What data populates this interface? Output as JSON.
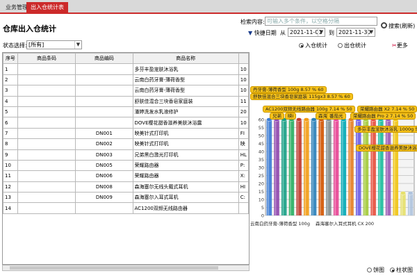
{
  "tabs": [
    {
      "label": "业务管理"
    },
    {
      "label": "出入仓统计表"
    }
  ],
  "page_title": "仓库出入仓统计",
  "search": {
    "label": "检索内容:",
    "placeholder": "可输入多个条件，以空格分隔",
    "button": "搜索(刷新)"
  },
  "date": {
    "label": "快捷日期",
    "from_label": "从",
    "from": "2021-11-01",
    "to_label": "到",
    "to": "2021-11-30"
  },
  "status": {
    "label": "状态选择:",
    "value": "[所有]"
  },
  "view_options": {
    "in_label": "入仓统计",
    "out_label": "出仓统计",
    "more_label": "更多",
    "selected": "in"
  },
  "chart_type": {
    "pie_label": "饼图",
    "bar_label": "柱状图",
    "selected": "bar"
  },
  "table": {
    "headers": [
      "序号",
      "商品条码",
      "商品编码",
      "商品名称",
      ""
    ],
    "rows": [
      {
        "no": "1",
        "barcode": "",
        "code": "",
        "name": "多芬丰盈宠肤沐浴乳",
        "extra": "10"
      },
      {
        "no": "2",
        "barcode": "",
        "code": "",
        "name": "云南白药牙膏-薄荷香型",
        "extra": "10"
      },
      {
        "no": "3",
        "barcode": "",
        "code": "",
        "name": "云南白药牙膏-薄荷香型",
        "extra": "10"
      },
      {
        "no": "4",
        "barcode": "",
        "code": "",
        "name": "舒肤佳混合三块香皂家庭装",
        "extra": "11"
      },
      {
        "no": "5",
        "barcode": "",
        "code": "",
        "name": "潘婷洗发水乳液修护",
        "extra": "20"
      },
      {
        "no": "6",
        "barcode": "",
        "code": "",
        "name": "DOVE樱花甜香滋养美肤沐浴露",
        "extra": "10"
      },
      {
        "no": "7",
        "barcode": "",
        "code": "DN001",
        "name": "映美针式打印机",
        "extra": "FI"
      },
      {
        "no": "8",
        "barcode": "",
        "code": "DN002",
        "name": "映美针式打印机",
        "extra": "映"
      },
      {
        "no": "9",
        "barcode": "",
        "code": "DN003",
        "name": "兄弟黑白激光打印机",
        "extra": "HL"
      },
      {
        "no": "10",
        "barcode": "",
        "code": "DN005",
        "name": "荣耀路由器",
        "extra": "P:"
      },
      {
        "no": "11",
        "barcode": "",
        "code": "DN006",
        "name": "荣耀路由器",
        "extra": "X:"
      },
      {
        "no": "12",
        "barcode": "",
        "code": "DN008",
        "name": "森海塞尔无线头戴式耳机",
        "extra": "HI"
      },
      {
        "no": "13",
        "barcode": "",
        "code": "DN009",
        "name": "森海塞尔入耳式耳机",
        "extra": "C:"
      },
      {
        "no": "14",
        "barcode": "",
        "code": "",
        "name": "AC1200双频无线路由器",
        "extra": ""
      }
    ]
  },
  "chart_data": {
    "type": "bar",
    "y_ticks": [
      "60",
      "55",
      "50",
      "45",
      "40",
      "35",
      "30",
      "25",
      "20",
      "15",
      "10",
      "5",
      "0"
    ],
    "ylim": [
      0,
      60
    ],
    "values": [
      60,
      60,
      60,
      60,
      60,
      60,
      60,
      60,
      60,
      60,
      60,
      60,
      60,
      60,
      60,
      60,
      60,
      60,
      14,
      14
    ],
    "bar_colors": [
      "#3a7bd5",
      "#8e44ad",
      "#16a085",
      "#27ae60",
      "#c0392b",
      "#f39c12",
      "#2980b9",
      "#d35400",
      "#7f8c8d",
      "#e84393",
      "#00a8b5",
      "#e67e22",
      "#6c5ce7",
      "#a3cb38",
      "#e74c3c",
      "#1abc9c",
      "#9b59b6",
      "#f1c40f",
      "#e6e06a",
      "#b0c4de"
    ],
    "tooltips": [
      "丹牙膏-薄荷香型 100g 8.57 % 60",
      "舒肤佳混合三块香皂家庭装 115gx3 8.57 % 60",
      "AC1200双频无线路由器 100g 7.14 % 50",
      "荣耀路由器 X2 7.14 % 50",
      "荣耀路由器 Pro 2 7.14 % 50",
      "多芬丰盈宠肤沐浴乳 1000g 5",
      "DOVE樱花甜香滋养美肤沐浴",
      "兄弟",
      "映I",
      "森海",
      "番茄光"
    ],
    "x_labels": [
      "云南白药牙膏-薄荷香型 100g",
      "森海塞尔入耳式耳机 CX 200"
    ]
  }
}
